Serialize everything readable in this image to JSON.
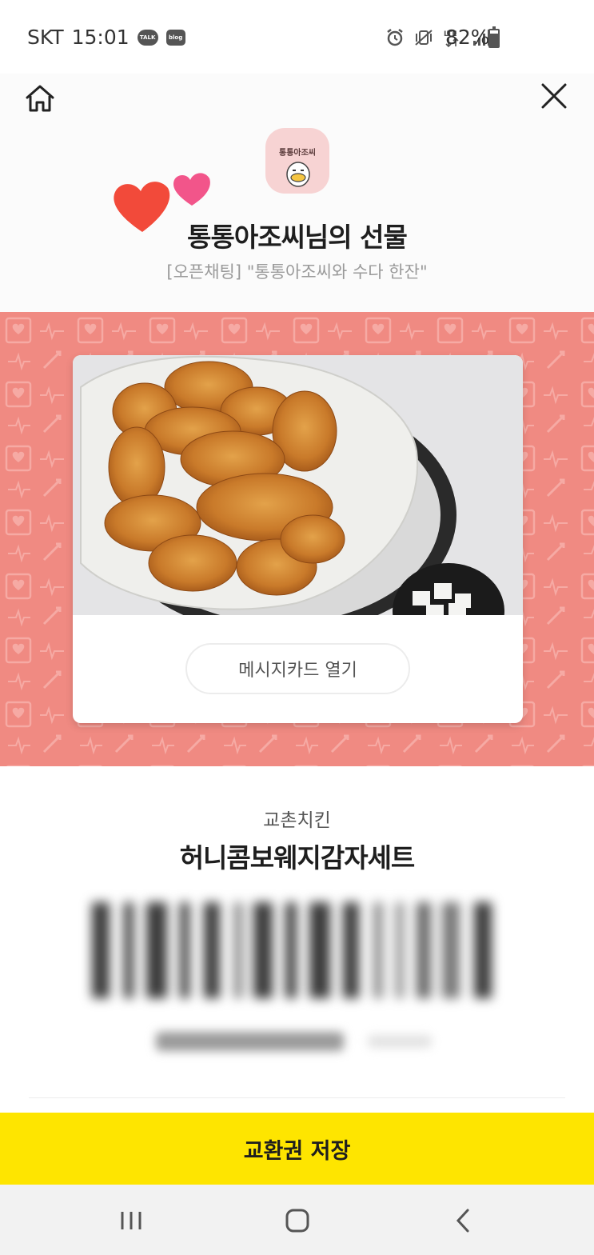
{
  "status_bar": {
    "carrier": "SKT",
    "time": "15:01",
    "notification_badges": [
      "TALK",
      "blog"
    ],
    "icons": [
      "alarm-icon",
      "vibrate-mute-icon",
      "lte-icon",
      "signal-icon"
    ],
    "lte_label": "LTE",
    "battery_percent": "82%",
    "battery_level": 0.82
  },
  "header": {
    "home_icon": "home-icon",
    "close_icon": "close-icon",
    "avatar_text": "통통아조씨",
    "title": "통통아조씨님의 선물",
    "subtitle": "[오픈채팅] \"통통아조씨와 수다 한잔\""
  },
  "gift_card": {
    "message_button": "메시지카드 열기",
    "background_color": "#f08a82"
  },
  "product": {
    "brand": "교촌치킨",
    "name": "허니콤보웨지감자세트"
  },
  "actions": {
    "save_label": "교환권 저장",
    "save_color": "#fee500"
  },
  "nav_bar": {
    "icons": [
      "recent-apps-icon",
      "home-nav-icon",
      "back-icon"
    ]
  }
}
